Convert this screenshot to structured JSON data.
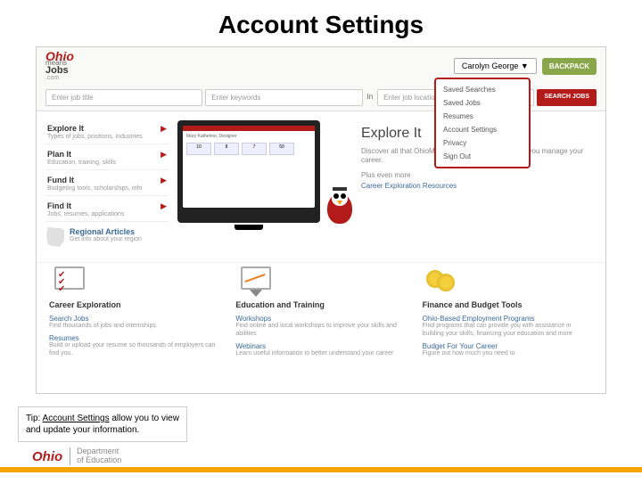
{
  "slide": {
    "title": "Account Settings"
  },
  "logo": {
    "ohio": "Ohio",
    "means": "means",
    "jobs": "Jobs",
    "com": ".com"
  },
  "user": {
    "name": "Carolyn George ▼",
    "backpack": "BACKPACK"
  },
  "dropdown": [
    "Saved Searches",
    "Saved Jobs",
    "Resumes",
    "Account Settings",
    "Privacy",
    "Sign Out"
  ],
  "search": {
    "title_ph": "Enter job title",
    "keywords_ph": "Enter keywords",
    "in": "In",
    "location_ph": "Enter job location",
    "button": "SEARCH JOBS"
  },
  "sidebar": [
    {
      "title": "Explore It",
      "sub": "Types of jobs, positions, industries"
    },
    {
      "title": "Plan It",
      "sub": "Education, training, skills"
    },
    {
      "title": "Fund It",
      "sub": "Budgeting tools, scholarships, info"
    },
    {
      "title": "Find It",
      "sub": "Jobs, resumes, applications"
    }
  ],
  "regional": {
    "title": "Regional Articles",
    "sub": "Get info about your region"
  },
  "hero": {
    "monitor_name": "Mary Katherine, Designer",
    "title": "Explore It",
    "sub": "Discover all that OhioMeansJobs has to offer to help you manage your career.",
    "more": "Plus even more",
    "link": "Career Exploration Resources"
  },
  "columns": [
    {
      "title": "Career Exploration",
      "items": [
        {
          "t": "Search Jobs",
          "s": "Find thousands of jobs and internships"
        },
        {
          "t": "Resumes",
          "s": "Build or upload your resume so thousands of employers can find you."
        }
      ]
    },
    {
      "title": "Education and Training",
      "items": [
        {
          "t": "Workshops",
          "s": "Find online and local workshops to improve your skills and abilities"
        },
        {
          "t": "Webinars",
          "s": "Learn useful information to better understand your career"
        }
      ]
    },
    {
      "title": "Finance and Budget Tools",
      "items": [
        {
          "t": "Ohio-Based Employment Programs",
          "s": "Find programs that can provide you with assistance in building your skills, financing your education and more"
        },
        {
          "t": "Budget For Your Career",
          "s": "Figure out how much you need to"
        }
      ]
    }
  ],
  "tip": {
    "prefix": "Tip: ",
    "em": "Account Settings",
    "suffix": " allow you to view and update your information."
  },
  "footer": {
    "ohio": "Ohio",
    "dept1": "Department",
    "dept2": "of Education"
  }
}
